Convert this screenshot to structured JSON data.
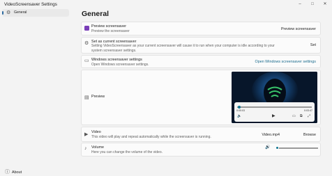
{
  "window": {
    "title": "VideoScreensaver Settings",
    "controls": {
      "minimize": "–",
      "maximize": "□",
      "close": "✕"
    }
  },
  "sidebar": {
    "items": [
      {
        "label": "General",
        "icon": "gear-icon",
        "selected": true
      }
    ],
    "footer": {
      "label": "About",
      "icon": "info-icon"
    }
  },
  "main": {
    "heading": "General",
    "preview_screensaver": {
      "title": "Preview screensaver",
      "subtitle": "Preview the screensaver",
      "action": "Preview screensaver",
      "icon": "screensaver-app-icon"
    },
    "set_current": {
      "title": "Set as current screensaver",
      "subtitle": "Setting VideoScreensaver as your current screensaver will cause it to run when your computer is idle according to your system screensaver settings.",
      "action": "Set",
      "icon": "settings-icon"
    },
    "windows_settings": {
      "title": "Windows screensaver settings",
      "subtitle": "Open Windows screensaver settings.",
      "action": "Open Windows screensaver settings",
      "icon": "monitor-icon"
    },
    "preview": {
      "title": "Preview",
      "icon": "preview-icon",
      "player": {
        "time_elapsed": "0:00:03",
        "time_remaining": "0:03:47",
        "progress": 0.02
      }
    },
    "video": {
      "title": "Video",
      "subtitle": "This video will play and repeat automatically while the screensaver is running.",
      "filename": "Video.mp4",
      "action": "Browse",
      "icon": "video-camera-icon"
    },
    "volume": {
      "title": "Volume",
      "subtitle": "Here you can change the volume of the video.",
      "icon": "volume-icon",
      "level": 0.0
    }
  },
  "colors": {
    "background": "#f3f3f3",
    "card": "#fbfbfb",
    "accent": "#0e7490",
    "link": "#1a6b8d"
  }
}
